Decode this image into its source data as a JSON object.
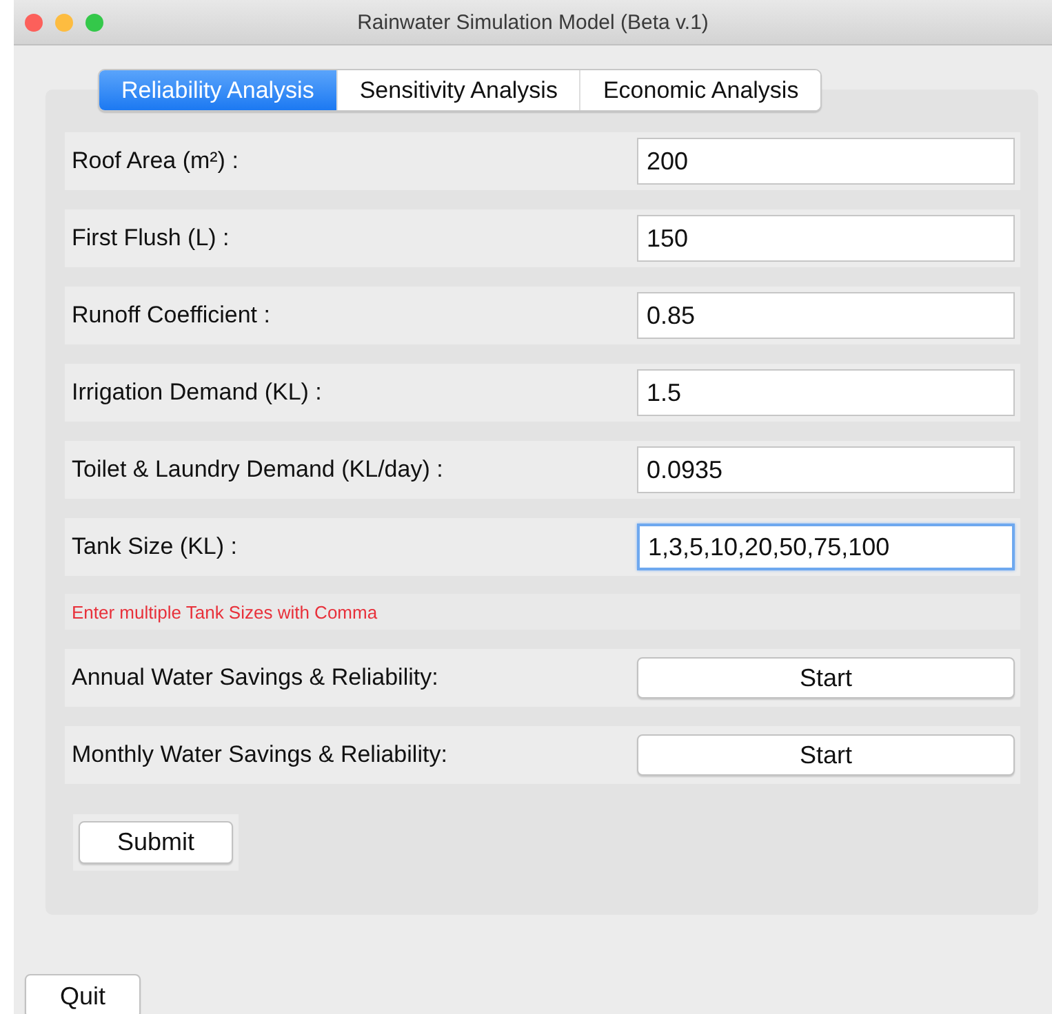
{
  "window": {
    "title": "Rainwater Simulation Model (Beta v.1)"
  },
  "tabs": [
    {
      "label": "Reliability Analysis",
      "selected": true
    },
    {
      "label": "Sensitivity Analysis",
      "selected": false
    },
    {
      "label": "Economic Analysis",
      "selected": false
    }
  ],
  "fields": [
    {
      "label": "Roof Area (m²) :",
      "value": "200",
      "focused": false
    },
    {
      "label": "First Flush (L) :",
      "value": "150",
      "focused": false
    },
    {
      "label": "Runoff Coefficient  :",
      "value": "0.85",
      "focused": false
    },
    {
      "label": "Irrigation Demand (KL) :",
      "value": "1.5",
      "focused": false
    },
    {
      "label": "Toilet & Laundry Demand (KL/day) :",
      "value": "0.0935",
      "focused": false
    },
    {
      "label": "Tank Size (KL) :",
      "value": "1,3,5,10,20,50,75,100",
      "focused": true
    }
  ],
  "hint": "Enter multiple Tank Sizes with Comma",
  "actions": [
    {
      "label": "Annual Water Savings & Reliability:",
      "button": "Start"
    },
    {
      "label": "Monthly Water Savings & Reliability:",
      "button": "Start"
    }
  ],
  "submit": "Submit",
  "quit": "Quit"
}
